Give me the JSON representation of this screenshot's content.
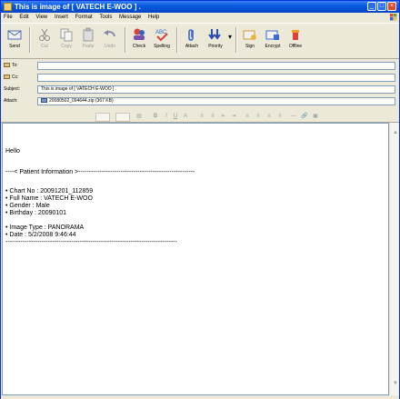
{
  "window": {
    "title": "This is image of [ VATECH E-WOO ] ."
  },
  "menu": [
    "File",
    "Edit",
    "View",
    "Insert",
    "Format",
    "Tools",
    "Message",
    "Help"
  ],
  "toolbar": [
    {
      "label": "Send",
      "icon": "send-icon",
      "enabled": true
    },
    {
      "label": "Cut",
      "icon": "scissors-icon",
      "enabled": false
    },
    {
      "label": "Copy",
      "icon": "copy-icon",
      "enabled": false
    },
    {
      "label": "Paste",
      "icon": "paste-icon",
      "enabled": false
    },
    {
      "label": "Undo",
      "icon": "undo-icon",
      "enabled": false
    },
    {
      "label": "Check",
      "icon": "check-names-icon",
      "enabled": true
    },
    {
      "label": "Spelling",
      "icon": "spelling-icon",
      "enabled": true
    },
    {
      "label": "Attach",
      "icon": "paperclip-icon",
      "enabled": true
    },
    {
      "label": "Priority",
      "icon": "priority-icon",
      "enabled": true
    },
    {
      "label": "Sign",
      "icon": "sign-icon",
      "enabled": true
    },
    {
      "label": "Encrypt",
      "icon": "encrypt-icon",
      "enabled": true
    },
    {
      "label": "Offline",
      "icon": "offline-icon",
      "enabled": true
    }
  ],
  "headers": {
    "to": {
      "label": "To:",
      "value": ""
    },
    "cc": {
      "label": "Cc:",
      "value": ""
    },
    "subject": {
      "label": "Subject:",
      "value": "This is image of [ VATECH E-WOO ] ."
    },
    "attach": {
      "label": "Attach:",
      "value": "20080502_094644.zip (367 KB)"
    }
  },
  "message": {
    "greeting": "Hello",
    "section_header": "----< Patient Information >-------------------------------------------------------",
    "lines": [
      "• Chart No : 20091201_112859",
      "• Full Name : VATECH E-WOO",
      "• Gender : Male",
      "• Birthday : 20090101",
      "• Image Type : PANORAMA",
      "• Date : 5/2/2008 9:46:44"
    ],
    "footer_rule": "---------------------------------------------------------------------------------"
  },
  "colors": {
    "titlebar": "#0553d8",
    "chrome": "#ece9d8",
    "field_border": "#7f9db9"
  }
}
